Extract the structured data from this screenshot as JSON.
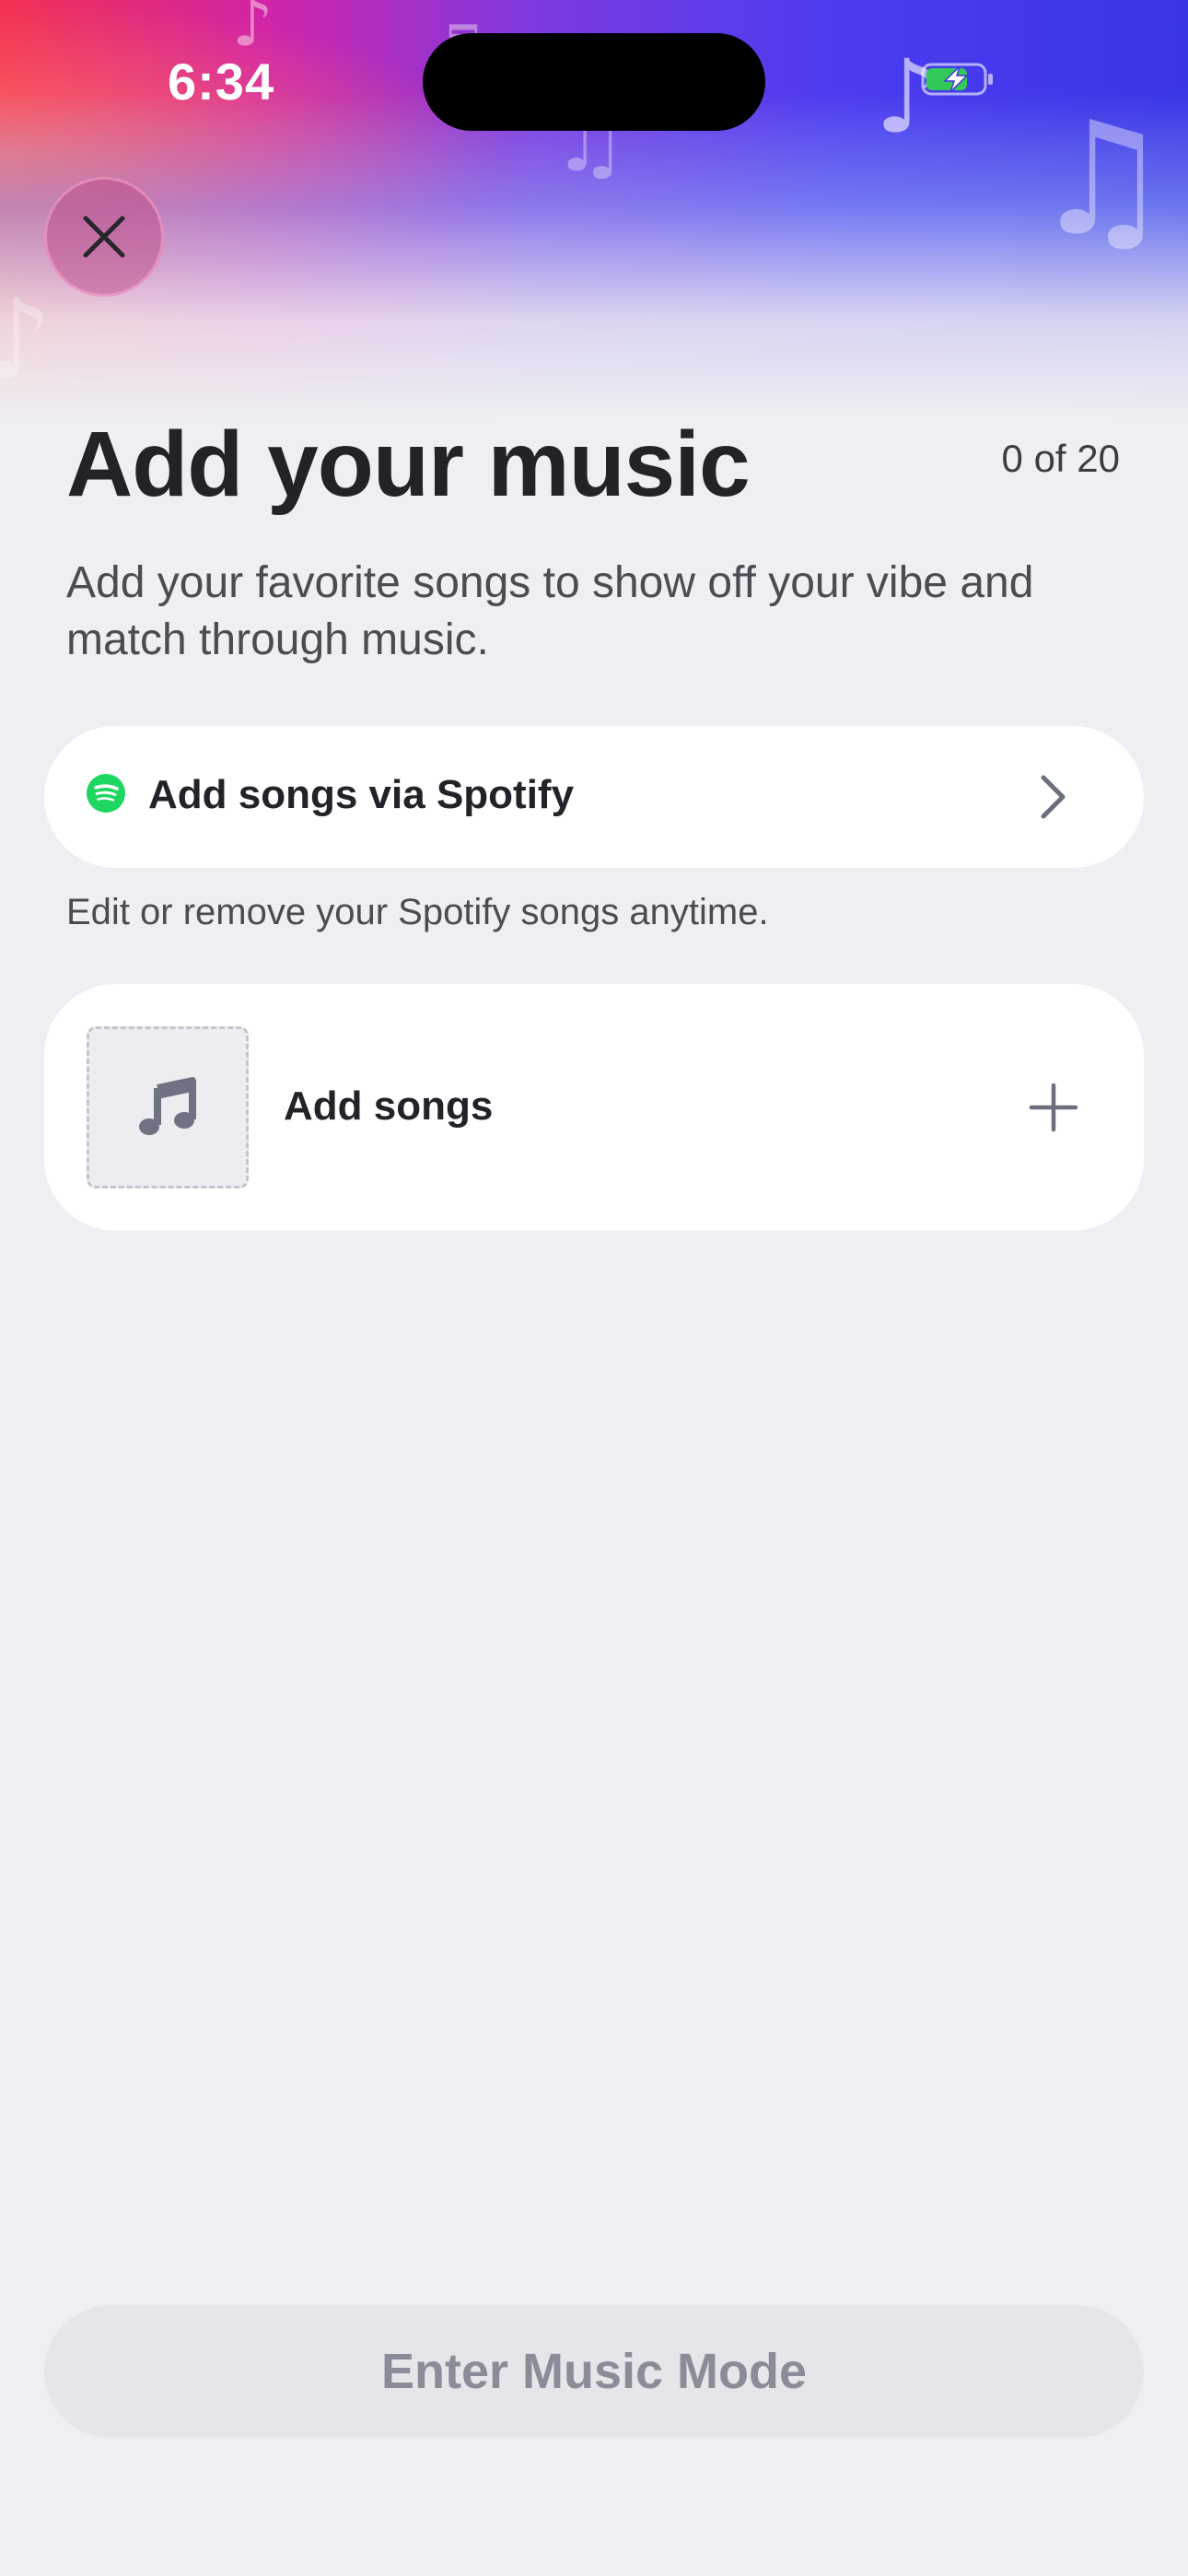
{
  "status_bar": {
    "time": "6:34",
    "battery_icon": "battery-charging-icon"
  },
  "header": {
    "close_icon": "close-icon"
  },
  "page": {
    "title": "Add your music",
    "counter": "0 of 20",
    "subtitle": "Add your favorite songs to show off your vibe and match through music."
  },
  "spotify": {
    "icon": "spotify-icon",
    "label": "Add songs via Spotify",
    "chevron_icon": "chevron-right-icon",
    "helper_text": "Edit or remove your Spotify songs anytime."
  },
  "add_songs": {
    "icon": "music-note-icon",
    "label": "Add songs",
    "plus_icon": "plus-icon"
  },
  "footer": {
    "cta_label": "Enter Music Mode"
  },
  "colors": {
    "background": "#efeff3",
    "spotify_green": "#1ed760",
    "cta_disabled_bg": "#e5e5ea",
    "cta_disabled_text": "#8a8c99"
  }
}
